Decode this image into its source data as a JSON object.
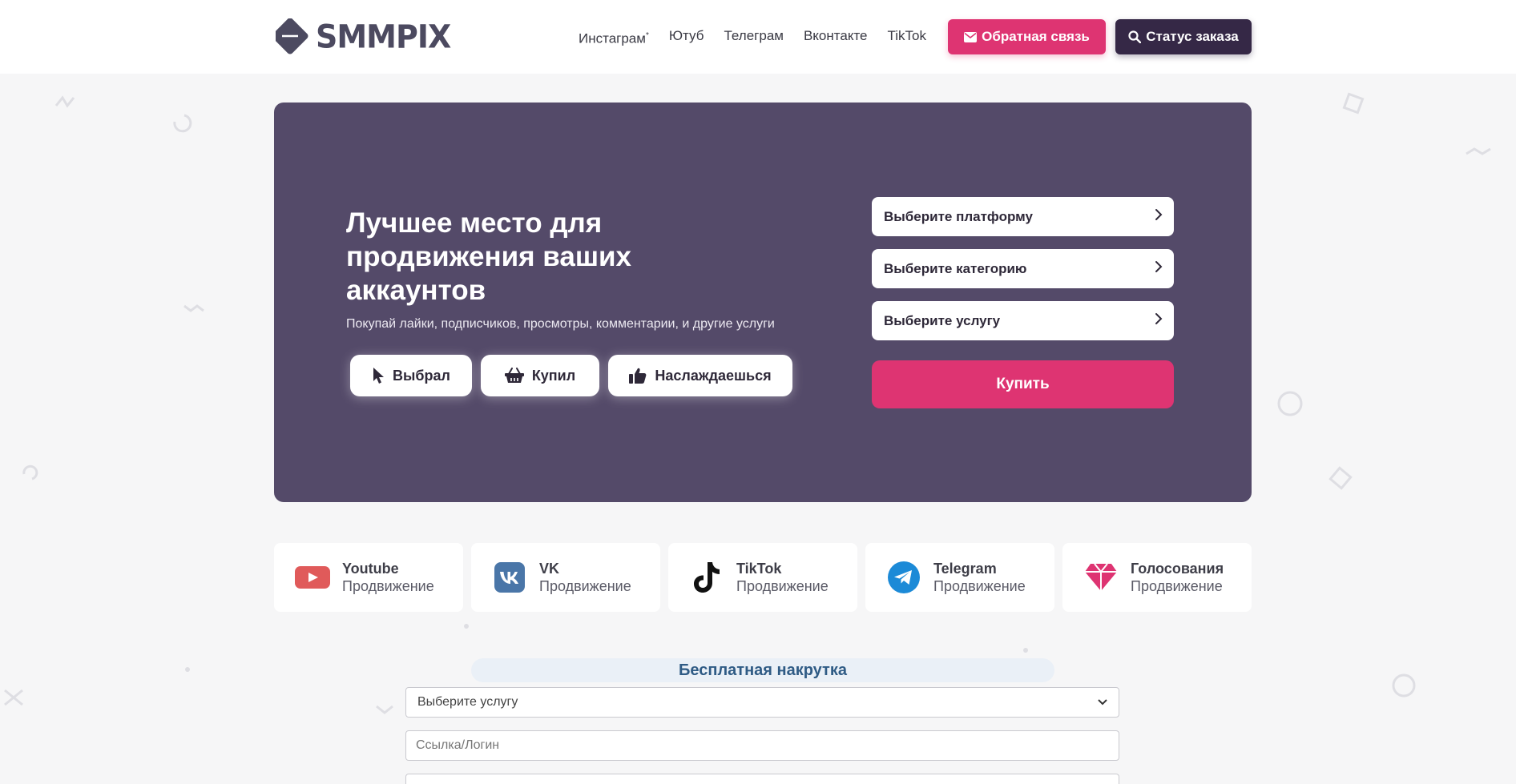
{
  "header": {
    "logo_text": "SMMPIX",
    "nav": [
      {
        "label": "Инстаграм",
        "sup": "*"
      },
      {
        "label": "Ютуб",
        "sup": ""
      },
      {
        "label": "Телеграм",
        "sup": ""
      },
      {
        "label": "Вконтакте",
        "sup": ""
      },
      {
        "label": "TikTok",
        "sup": ""
      }
    ],
    "feedback_label": "Обратная связь",
    "feedback_icon": "envelope-icon",
    "status_label": "Статус заказа",
    "status_icon": "search-icon"
  },
  "hero": {
    "title": "Лучшее место для продвижения ваших аккаунтов",
    "subtitle": "Покупай лайки, подписчиков, просмотры, комментарии, и другие услуги",
    "steps": [
      {
        "label": "Выбрал",
        "icon": "cursor-icon"
      },
      {
        "label": "Купил",
        "icon": "basket-icon"
      },
      {
        "label": "Наслаждаешься",
        "icon": "thumbs-up-icon"
      }
    ],
    "selects": [
      {
        "label": "Выберите платформу"
      },
      {
        "label": "Выберите категорию"
      },
      {
        "label": "Выберите услугу"
      }
    ],
    "buy_label": "Купить"
  },
  "platforms": [
    {
      "name": "Youtube",
      "sub": "Продвижение",
      "icon": "youtube-icon",
      "color": "#e05a5a"
    },
    {
      "name": "VK",
      "sub": "Продвижение",
      "icon": "vk-icon",
      "color": "#4a76a8"
    },
    {
      "name": "TikTok",
      "sub": "Продвижение",
      "icon": "tiktok-icon",
      "color": "#111111"
    },
    {
      "name": "Telegram",
      "sub": "Продвижение",
      "icon": "telegram-icon",
      "color": "#1c8ad7"
    },
    {
      "name": "Голосования",
      "sub": "Продвижение",
      "icon": "diamond-icon",
      "color": "#de3472"
    }
  ],
  "free": {
    "title": "Бесплатная накрутка",
    "select_value": "Выберите услугу",
    "link_placeholder": "Ссылка/Логин"
  },
  "colors": {
    "accent": "#de3472",
    "dark": "#352846",
    "hero_bg": "#544a69"
  }
}
